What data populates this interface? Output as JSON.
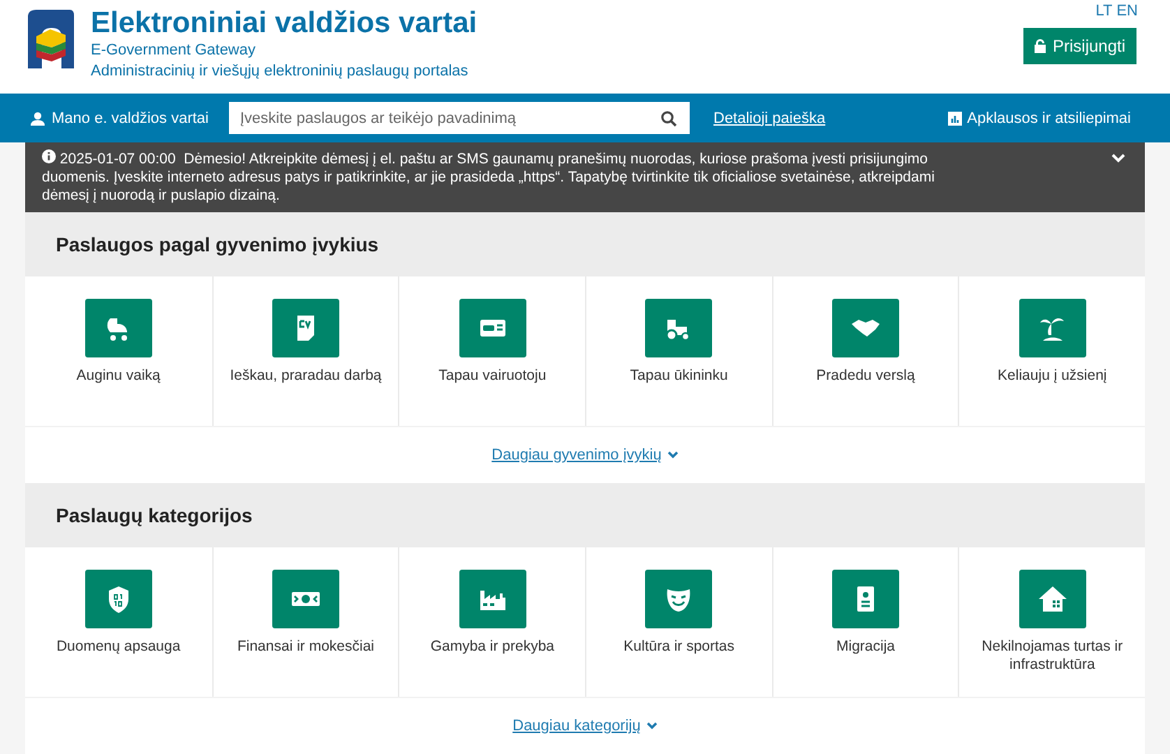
{
  "header": {
    "title": "Elektroniniai valdžios vartai",
    "subtitle": "E-Government Gateway",
    "tagline": "Administracinių ir viešųjų elektroninių paslaugų portalas",
    "languages": [
      "LT",
      "EN"
    ],
    "login_button": "Prisijungti"
  },
  "nav": {
    "account_link": "Mano e. valdžios vartai",
    "search": {
      "placeholder": "Įveskite paslaugos ar teikėjo pavadinimą"
    },
    "detailed_search": "Detalioji paieška",
    "feedback_link": "Apklausos ir atsiliepimai"
  },
  "notice": {
    "date": "2025-01-07 00:00",
    "text": "Dėmesio! Atkreipkite dėmesį į el. paštu ar SMS gaunamų pranešimų nuorodas, kuriose prašoma įvesti prisijungimo duomenis. Įveskite interneto adresus patys ir patikrinkite, ar jie prasideda „https“. Tapatybę tvirtinkite tik oficialiose svetainėse, atkreipdami dėmesį į nuorodą ir puslapio dizainą.",
    "expanded": false
  },
  "sections": [
    {
      "title": "Paslaugos pagal gyvenimo įvykius",
      "tiles": [
        {
          "label": "Auginu vaiką"
        },
        {
          "label": "Ieškau, praradau darbą"
        },
        {
          "label": "Tapau vairuotoju"
        },
        {
          "label": "Tapau ūkininku"
        },
        {
          "label": "Pradedu verslą"
        },
        {
          "label": "Keliauju į užsienį"
        }
      ],
      "more_link": "Daugiau gyvenimo įvykių"
    },
    {
      "title": "Paslaugų kategorijos",
      "tiles": [
        {
          "label": "Duomenų apsauga"
        },
        {
          "label": "Finansai ir mokesčiai"
        },
        {
          "label": "Gamyba ir prekyba"
        },
        {
          "label": "Kultūra ir sportas"
        },
        {
          "label": "Migracija"
        },
        {
          "label": "Nekilnojamas turtas ir infrastruktūra"
        }
      ],
      "more_link": "Daugiau kategorijų"
    }
  ]
}
